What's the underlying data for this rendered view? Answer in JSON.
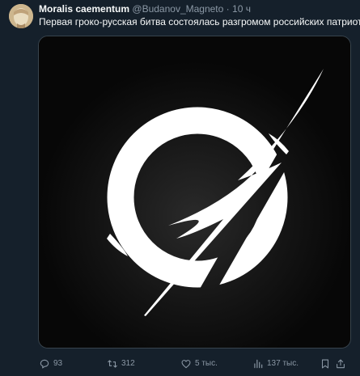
{
  "tweet": {
    "author_name": "Moralis caementum",
    "author_handle": "@Budanov_Magneto",
    "separator": "·",
    "time": "10 ч",
    "text": "Первая гроко-русская битва состоялась разгромом российских патриотов.",
    "image_icon": "circle-slash-logo"
  },
  "actions": {
    "reply": {
      "icon": "comment-icon",
      "count": "93"
    },
    "retweet": {
      "icon": "retweet-icon",
      "count": "312"
    },
    "like": {
      "icon": "heart-icon",
      "count": "5 тыс."
    },
    "views": {
      "icon": "analytics-icon",
      "count": "137 тыс."
    },
    "bookmark": {
      "icon": "bookmark-icon"
    },
    "share": {
      "icon": "share-icon"
    }
  },
  "colors": {
    "background": "#15202b",
    "primary_text": "#f7f9f9",
    "secondary_text": "#8b98a5",
    "image_background": "#090909",
    "logo": "#ffffff"
  }
}
